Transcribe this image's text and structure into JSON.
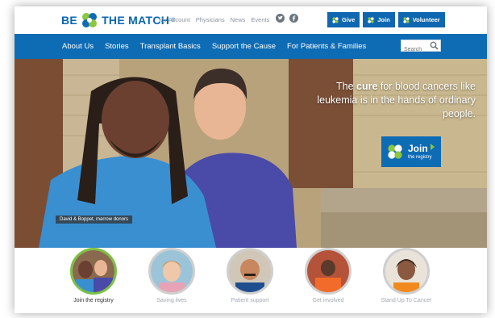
{
  "header": {
    "logo_be": "BE",
    "logo_match": "THE MATCH",
    "logo_reg": "®",
    "utility_links": [
      "My Account",
      "Physicians",
      "News",
      "Events"
    ],
    "buttons": [
      {
        "label": "Give"
      },
      {
        "label": "Join"
      },
      {
        "label": "Volunteer"
      }
    ]
  },
  "nav": {
    "items": [
      "About Us",
      "Stories",
      "Transplant Basics",
      "Support the Cause",
      "For Patients & Families"
    ],
    "search_placeholder": "Search"
  },
  "hero": {
    "tagline_pre": "The ",
    "tagline_bold": "cure",
    "tagline_post": " for blood cancers like leukemia is in the hands of ordinary people.",
    "cta_big": "Join",
    "cta_small": "the registry",
    "caption": "David & Boppet, marrow donors"
  },
  "circles": [
    {
      "label": "Join the registry",
      "active": true
    },
    {
      "label": "Saving lives",
      "active": false
    },
    {
      "label": "Patient support",
      "active": false
    },
    {
      "label": "Get involved",
      "active": false
    },
    {
      "label": "Stand Up To Cancer",
      "active": false
    }
  ],
  "colors": {
    "brand_blue": "#0e6cb5",
    "active_ring": "#7cc242",
    "logo_green": "#8dc63f"
  }
}
